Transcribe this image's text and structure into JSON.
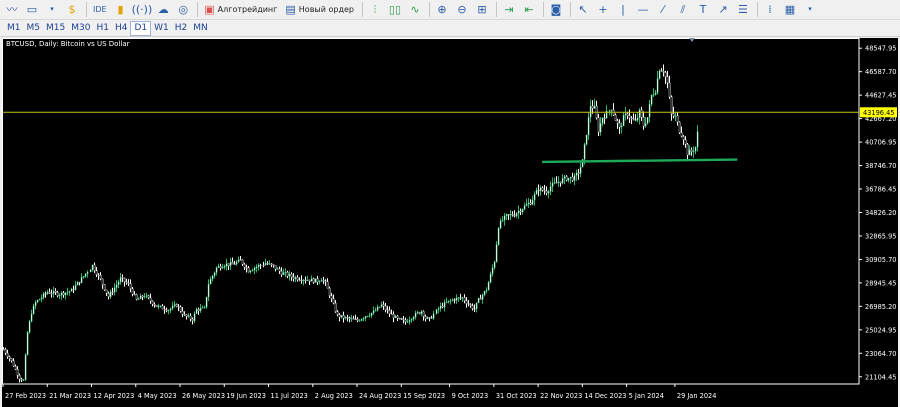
{
  "toolbar": {
    "algo_label": "Алготрейдинг",
    "order_label": "Новый ордер",
    "ide_label": "IDE"
  },
  "timeframes": [
    {
      "label": "M1",
      "active": false
    },
    {
      "label": "M5",
      "active": false
    },
    {
      "label": "M15",
      "active": false
    },
    {
      "label": "M30",
      "active": false
    },
    {
      "label": "H1",
      "active": false
    },
    {
      "label": "H4",
      "active": false
    },
    {
      "label": "D1",
      "active": true
    },
    {
      "label": "W1",
      "active": false
    },
    {
      "label": "H2",
      "active": false
    },
    {
      "label": "MN",
      "active": false
    }
  ],
  "chart": {
    "title": "BTCUSD, Daily:  Bitcoin vs US Dollar",
    "price_labels": [
      "48547.95",
      "46587.70",
      "44627.45",
      "42667.20",
      "40706.95",
      "38746.70",
      "36786.45",
      "34826.20",
      "32865.95",
      "30905.70",
      "28945.45",
      "26985.20",
      "25024.95",
      "23064.70",
      "21104.45"
    ],
    "current_price": "43196.45",
    "date_labels": [
      "27 Feb 2023",
      "21 Mar 2023",
      "12 Apr 2023",
      "4 May 2023",
      "26 May 2023",
      "19 Jun 2023",
      "11 Jul 2023",
      "2 Aug 2023",
      "24 Aug 2023",
      "15 Sep 2023",
      "9 Oct 2023",
      "31 Oct 2023",
      "22 Nov 2023",
      "14 Dec 2023",
      "5 Jan 2024",
      "29 Jan 2024"
    ],
    "colors": {
      "up": "#2fb36b",
      "down": "#ffffff",
      "bull_body": "#ffffff",
      "bear_body": "#000000",
      "level": "#c8c41a",
      "support": "#1faa5a",
      "axis_text": "#ffffff",
      "price_tag": "#ffff00"
    }
  },
  "chart_data": {
    "type": "candlestick",
    "symbol": "BTCUSD",
    "timeframe": "D1",
    "x_range": [
      "27 Feb 2023",
      "6 Feb 2024"
    ],
    "ylim": [
      20500,
      49400
    ],
    "horizontal_level": 43196.45,
    "support_line": {
      "from": {
        "date": "22 Nov 2023",
        "price": 39050
      },
      "to": {
        "date": "29 Feb 2024",
        "price": 39250
      }
    },
    "path": [
      [
        0,
        23400
      ],
      [
        4,
        22400
      ],
      [
        8,
        21000
      ],
      [
        10,
        20800
      ],
      [
        12,
        24800
      ],
      [
        14,
        26500
      ],
      [
        16,
        27300
      ],
      [
        22,
        28200
      ],
      [
        28,
        28000
      ],
      [
        34,
        28300
      ],
      [
        40,
        29500
      ],
      [
        44,
        30400
      ],
      [
        48,
        29200
      ],
      [
        52,
        27800
      ],
      [
        58,
        29300
      ],
      [
        62,
        28800
      ],
      [
        66,
        27500
      ],
      [
        70,
        27900
      ],
      [
        76,
        27000
      ],
      [
        82,
        26700
      ],
      [
        86,
        27100
      ],
      [
        90,
        26200
      ],
      [
        94,
        25900
      ],
      [
        96,
        26700
      ],
      [
        100,
        26800
      ],
      [
        102,
        28900
      ],
      [
        106,
        30200
      ],
      [
        110,
        30500
      ],
      [
        114,
        30500
      ],
      [
        118,
        30800
      ],
      [
        122,
        30000
      ],
      [
        126,
        30300
      ],
      [
        130,
        30600
      ],
      [
        134,
        30300
      ],
      [
        138,
        29800
      ],
      [
        144,
        29400
      ],
      [
        148,
        29300
      ],
      [
        152,
        29200
      ],
      [
        156,
        29100
      ],
      [
        158,
        29300
      ],
      [
        160,
        28900
      ],
      [
        166,
        26200
      ],
      [
        170,
        26000
      ],
      [
        176,
        25800
      ],
      [
        180,
        26200
      ],
      [
        184,
        26500
      ],
      [
        188,
        27100
      ],
      [
        192,
        26400
      ],
      [
        196,
        25900
      ],
      [
        200,
        25700
      ],
      [
        204,
        26200
      ],
      [
        208,
        26600
      ],
      [
        210,
        26000
      ],
      [
        212,
        25900
      ],
      [
        216,
        26800
      ],
      [
        220,
        27300
      ],
      [
        224,
        27600
      ],
      [
        228,
        27700
      ],
      [
        232,
        27000
      ],
      [
        234,
        26800
      ],
      [
        236,
        27500
      ],
      [
        240,
        28400
      ],
      [
        242,
        29600
      ],
      [
        244,
        30800
      ],
      [
        246,
        33700
      ],
      [
        248,
        34200
      ],
      [
        250,
        34500
      ],
      [
        254,
        34700
      ],
      [
        258,
        35200
      ],
      [
        262,
        35700
      ],
      [
        266,
        36800
      ],
      [
        270,
        36600
      ],
      [
        272,
        37000
      ],
      [
        276,
        37400
      ],
      [
        280,
        37700
      ],
      [
        284,
        37700
      ],
      [
        286,
        38200
      ],
      [
        288,
        39100
      ],
      [
        290,
        41500
      ],
      [
        292,
        43800
      ],
      [
        294,
        43500
      ],
      [
        296,
        41700
      ],
      [
        298,
        42800
      ],
      [
        300,
        43100
      ],
      [
        302,
        43600
      ],
      [
        304,
        42600
      ],
      [
        306,
        41800
      ],
      [
        308,
        42700
      ],
      [
        310,
        43100
      ],
      [
        312,
        42600
      ],
      [
        314,
        42400
      ],
      [
        316,
        43200
      ],
      [
        318,
        42100
      ],
      [
        320,
        42800
      ],
      [
        322,
        44600
      ],
      [
        324,
        45100
      ],
      [
        326,
        46900
      ],
      [
        328,
        46700
      ],
      [
        330,
        45600
      ],
      [
        332,
        43000
      ],
      [
        334,
        42800
      ],
      [
        336,
        41700
      ],
      [
        338,
        41100
      ],
      [
        340,
        39800
      ],
      [
        342,
        39900
      ],
      [
        344,
        40300
      ],
      [
        346,
        42600
      ],
      [
        348,
        43200
      ],
      [
        350,
        43000
      ]
    ]
  }
}
